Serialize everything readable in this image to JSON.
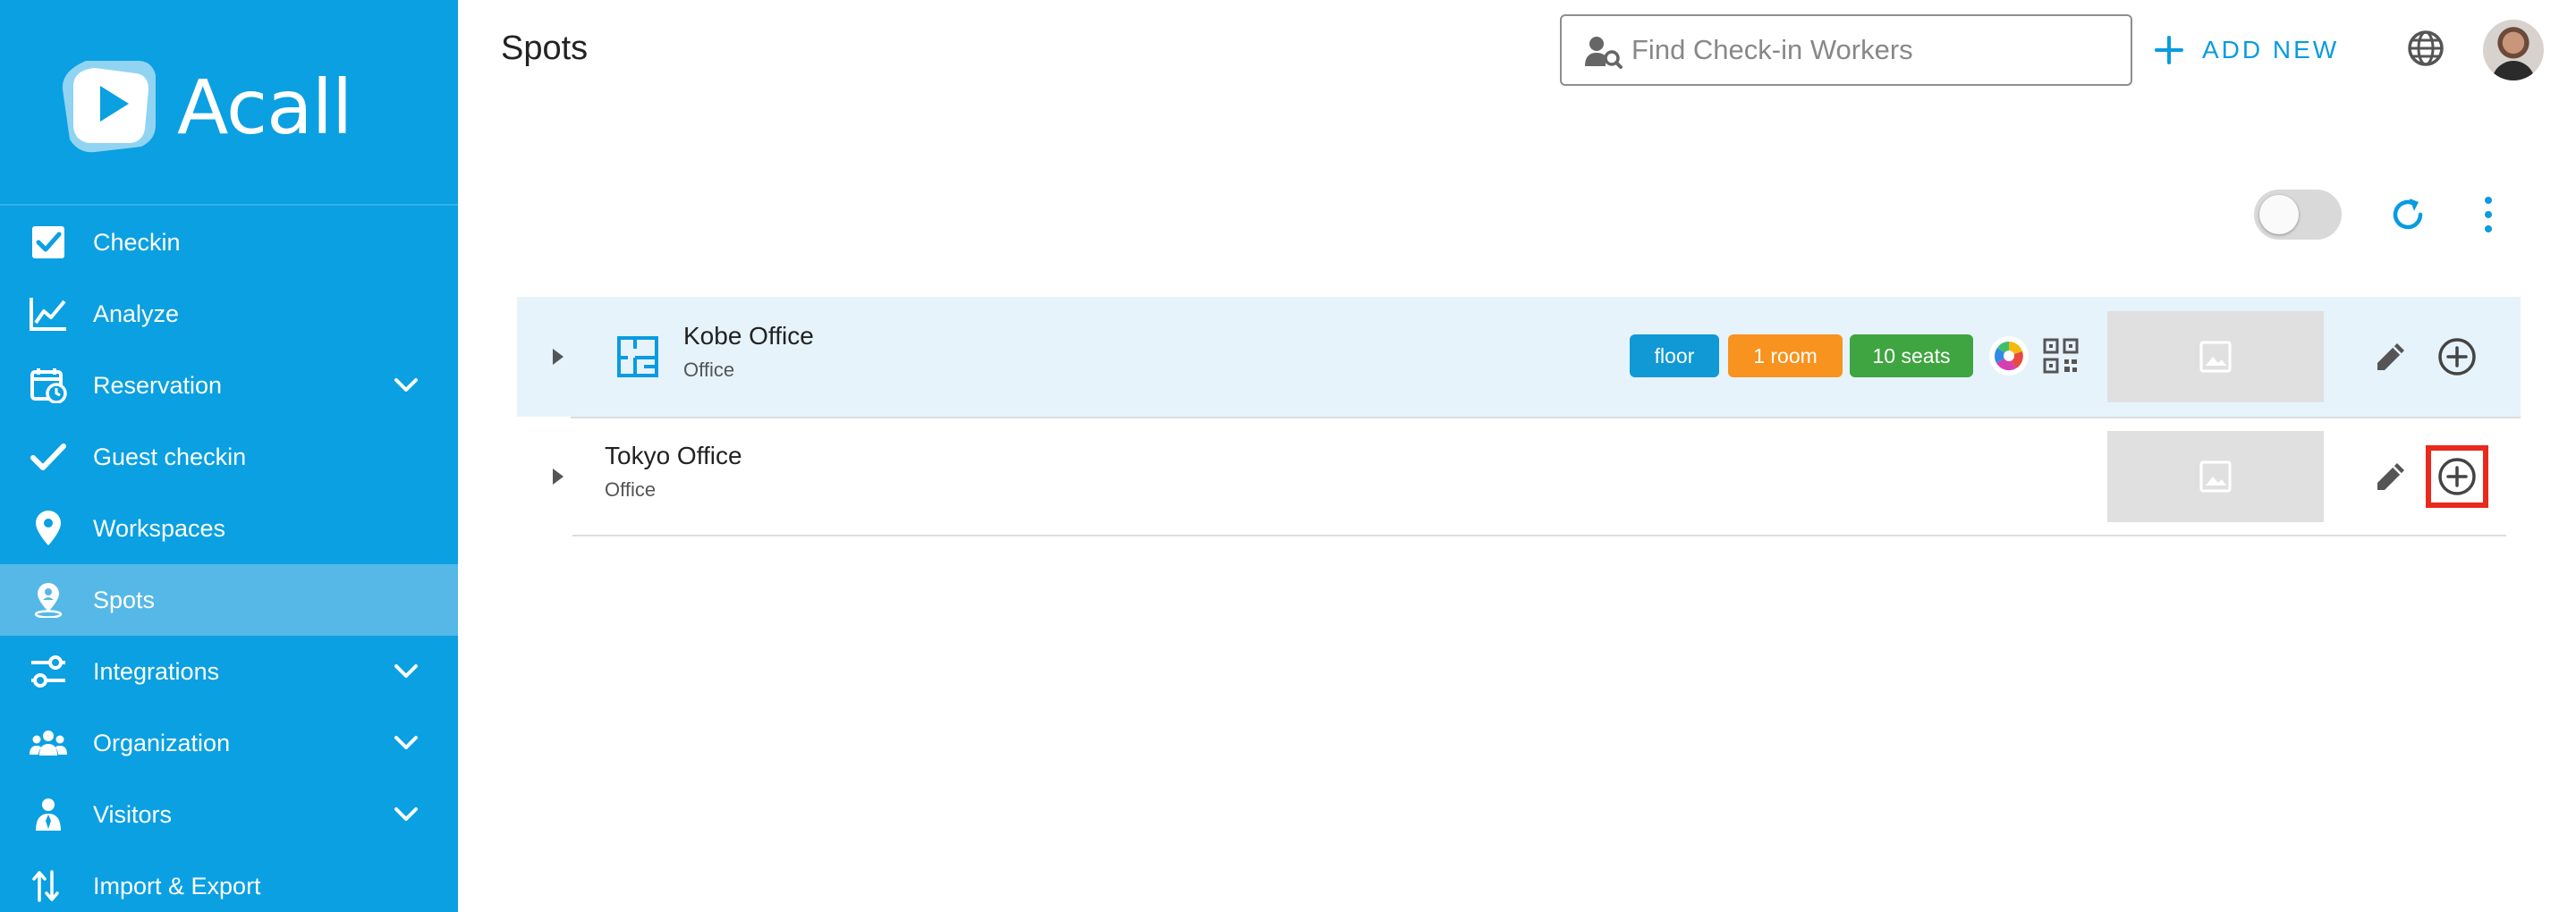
{
  "app": {
    "logo_text": "Acall",
    "brand_color": "#0aa0e2"
  },
  "sidebar": {
    "items": [
      {
        "label": "Checkin",
        "icon": "checkbox-icon",
        "has_chevron": false,
        "active": false
      },
      {
        "label": "Analyze",
        "icon": "line-chart-icon",
        "has_chevron": false,
        "active": false
      },
      {
        "label": "Reservation",
        "icon": "calendar-clock-icon",
        "has_chevron": true,
        "active": false
      },
      {
        "label": "Guest checkin",
        "icon": "checkmark-icon",
        "has_chevron": false,
        "active": false
      },
      {
        "label": "Workspaces",
        "icon": "map-pin-icon",
        "has_chevron": false,
        "active": false
      },
      {
        "label": "Spots",
        "icon": "location-person-icon",
        "has_chevron": false,
        "active": true
      },
      {
        "label": "Integrations",
        "icon": "sliders-icon",
        "has_chevron": true,
        "active": false
      },
      {
        "label": "Organization",
        "icon": "people-group-icon",
        "has_chevron": true,
        "active": false
      },
      {
        "label": "Visitors",
        "icon": "visitor-icon",
        "has_chevron": true,
        "active": false
      },
      {
        "label": "Import & Export",
        "icon": "import-export-icon",
        "has_chevron": false,
        "active": false
      }
    ]
  },
  "header": {
    "title": "Spots",
    "search": {
      "placeholder": "Find Check-in Workers",
      "value": ""
    },
    "add_new_label": "ADD NEW"
  },
  "toolbar": {
    "toggle_on": false
  },
  "spots": [
    {
      "name": "Kobe Office",
      "type": "Office",
      "tags": [
        "floor",
        "1 room",
        "10 seats"
      ],
      "tag_colors": [
        "#1199d6",
        "#f7931e",
        "#3fa540"
      ],
      "highlighted": true
    },
    {
      "name": "Tokyo Office",
      "type": "Office",
      "tags": [],
      "highlighted": false
    }
  ],
  "annotation_color": "#e8291c"
}
